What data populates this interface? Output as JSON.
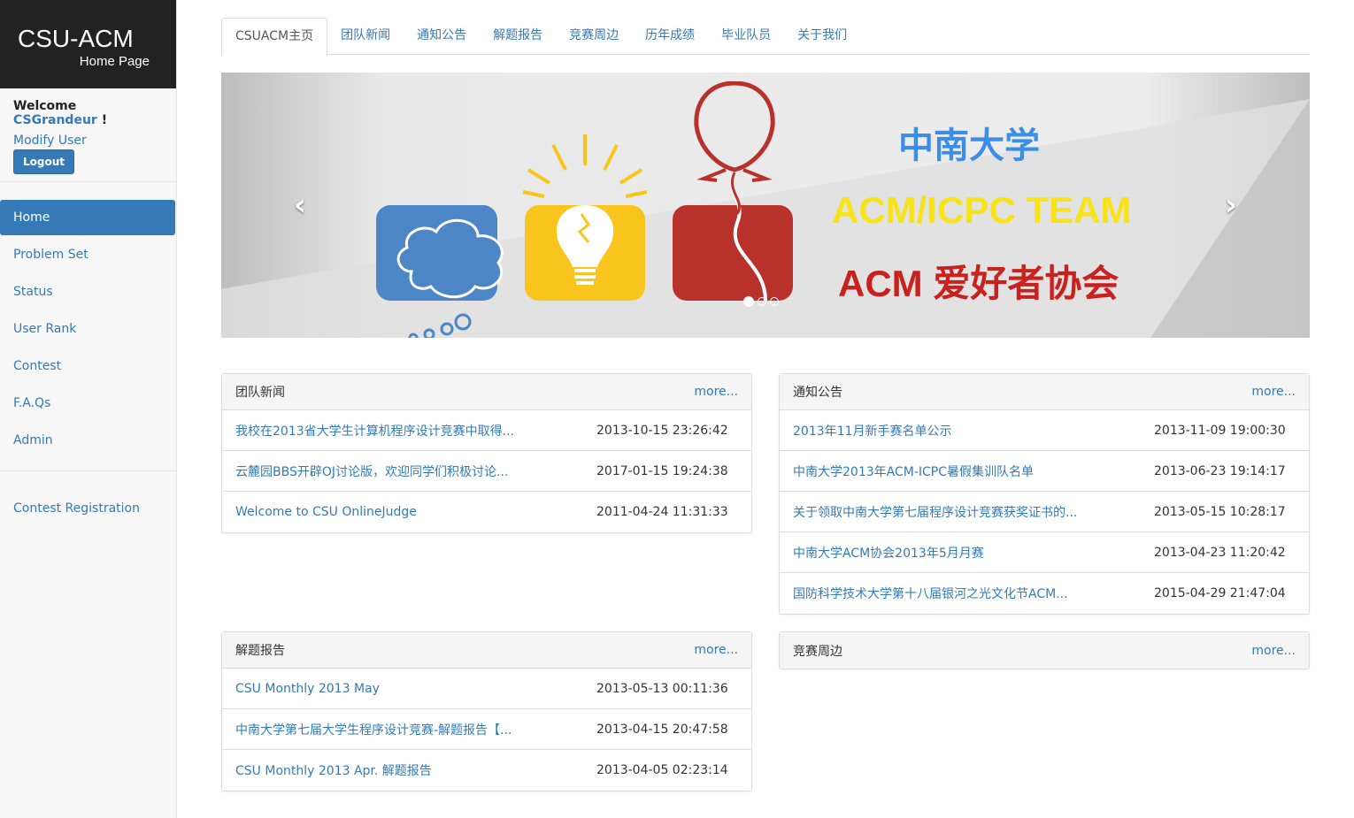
{
  "brand": {
    "title": "CSU-ACM",
    "subtitle": "Home Page"
  },
  "user": {
    "welcome_prefix": "Welcome",
    "username": "CSGrandeur",
    "welcome_suffix": "!",
    "modify": "Modify User",
    "logout": "Logout"
  },
  "nav": {
    "items": [
      {
        "label": "Home",
        "active": true
      },
      {
        "label": "Problem Set"
      },
      {
        "label": "Status"
      },
      {
        "label": "User Rank"
      },
      {
        "label": "Contest"
      },
      {
        "label": "F.A.Qs"
      },
      {
        "label": "Admin"
      }
    ],
    "extra": [
      {
        "label": "Contest Registration"
      }
    ]
  },
  "tabs": [
    "CSUACM主页",
    "团队新闻",
    "通知公告",
    "解题报告",
    "竞赛周边",
    "历年成绩",
    "毕业队员",
    "关于我们"
  ],
  "carousel": {
    "line1": "中南大学",
    "line2": "ACM/ICPC TEAM",
    "line3": "ACM 爱好者协会",
    "prev": "‹",
    "next": "›",
    "colors": {
      "blue": "#4d86c6",
      "yellow": "#f9c51d",
      "red": "#b8312a"
    }
  },
  "panels": {
    "news": {
      "title": "团队新闻",
      "more": "more...",
      "rows": [
        {
          "title": "我校在2013省大学生计算机程序设计竞赛中取得...",
          "date": "2013-10-15 23:26:42"
        },
        {
          "title": "云麓园BBS开辟OJ讨论版，欢迎同学们积极讨论...",
          "date": "2017-01-15 19:24:38"
        },
        {
          "title": "Welcome to CSU OnlineJudge",
          "date": "2011-04-24 11:31:33"
        }
      ]
    },
    "notice": {
      "title": "通知公告",
      "more": "more...",
      "rows": [
        {
          "title": "2013年11月新手赛名单公示",
          "date": "2013-11-09 19:00:30"
        },
        {
          "title": "中南大学2013年ACM-ICPC暑假集训队名单",
          "date": "2013-06-23 19:14:17"
        },
        {
          "title": "关于领取中南大学第七届程序设计竞赛获奖证书的...",
          "date": "2013-05-15 10:28:17"
        },
        {
          "title": "中南大学ACM协会2013年5月月赛",
          "date": "2013-04-23 11:20:42"
        },
        {
          "title": "国防科学技术大学第十八届银河之光文化节ACM...",
          "date": "2015-04-29 21:47:04"
        }
      ]
    },
    "reports": {
      "title": "解题报告",
      "more": "more...",
      "rows": [
        {
          "title": "CSU Monthly 2013 May",
          "date": "2013-05-13 00:11:36"
        },
        {
          "title": "中南大学第七届大学生程序设计竞赛-解题报告【...",
          "date": "2013-04-15 20:47:58"
        },
        {
          "title": "CSU Monthly 2013 Apr. 解题报告",
          "date": "2013-04-05 02:23:14"
        }
      ]
    },
    "around": {
      "title": "竞赛周边",
      "more": "more...",
      "rows": []
    }
  }
}
